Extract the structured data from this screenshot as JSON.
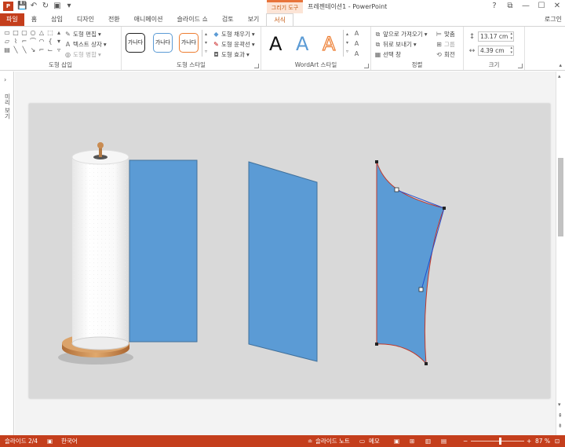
{
  "title_bar": {
    "app_icon": "P",
    "context_tab": "그리기 도구",
    "title": "프레젠테이션1 - PowerPoint",
    "window_controls": [
      "?",
      "⧉",
      "—",
      "☐",
      "✕"
    ]
  },
  "tabs": [
    "파일",
    "홈",
    "삽입",
    "디자인",
    "전환",
    "애니메이션",
    "슬라이드 쇼",
    "검토",
    "보기",
    "서식"
  ],
  "login": "로그인",
  "ribbon": {
    "insert_shapes": {
      "label": "도형 삽입",
      "edit_shape": "도형 편집",
      "text_box": "텍스트 상자",
      "merge_shapes": "도형 병합"
    },
    "shape_styles": {
      "label": "도형 스타일",
      "preview_text": "가나다",
      "fill": "도형 채우기",
      "outline": "도형 윤곽선",
      "effects": "도형 효과"
    },
    "wordart": {
      "label": "WordArt 스타일",
      "letter": "A"
    },
    "arrange": {
      "label": "정렬",
      "bring_forward": "앞으로 가져오기",
      "send_backward": "뒤로 보내기",
      "selection_pane": "선택 창",
      "align": "맞춤",
      "group": "그룹",
      "rotate": "회전"
    },
    "size": {
      "label": "크기",
      "height": "13.17 cm",
      "width": "4.39 cm"
    }
  },
  "left_panel": {
    "label": "미리 보기"
  },
  "status": {
    "slide": "슬라이드 2/4",
    "language": "한국어",
    "notes": "슬라이드 노트",
    "comments": "메모",
    "zoom": "87 %",
    "zoom_fraction": 0.55
  },
  "colors": {
    "accent": "#c43e1c",
    "shape_fill": "#5b9bd5",
    "shape_stroke": "#41719c",
    "slide_bg": "#d9d9d9",
    "wood": "#c68a55"
  }
}
